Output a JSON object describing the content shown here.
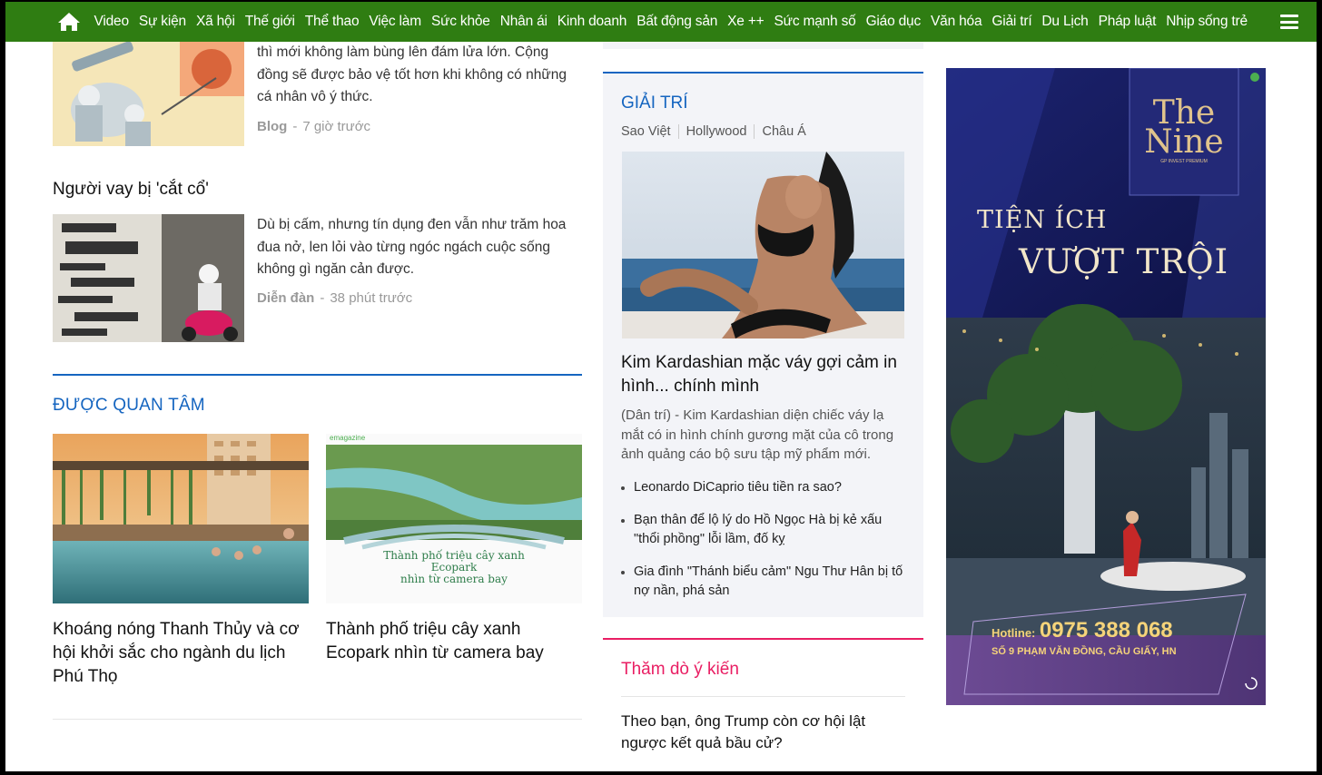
{
  "nav": {
    "items": [
      "Video",
      "Sự kiện",
      "Xã hội",
      "Thế giới",
      "Thể thao",
      "Việc làm",
      "Sức khỏe",
      "Nhân ái",
      "Kinh doanh",
      "Bất động sản",
      "Xe ++",
      "Sức mạnh số",
      "Giáo dục",
      "Văn hóa",
      "Giải trí",
      "Du Lịch",
      "Pháp luật",
      "Nhịp sống trẻ"
    ]
  },
  "left": {
    "story1": {
      "excerpt": "thì mới không làm bùng lên đám lửa lớn. Cộng đồng sẽ được bảo vệ tốt hơn khi không có những cá nhân vô ý thức.",
      "category": "Blog",
      "time": "7 giờ trước"
    },
    "story2": {
      "title": "Người vay bị 'cắt cổ'",
      "excerpt": "Dù bị cấm, nhưng tín dụng đen vẫn như trăm hoa đua nở, len lỏi vào từng ngóc ngách cuộc sống không gì ngăn cản được.",
      "category": "Diễn đàn",
      "time": "38 phút trước"
    },
    "separator": "-",
    "featured": {
      "heading": "ĐƯỢC QUAN TÂM",
      "cards": [
        {
          "title": "Khoáng nóng Thanh Thủy và cơ hội khởi sắc cho ngành du lịch Phú Thọ"
        },
        {
          "title": "Thành phố triệu cây xanh Ecopark nhìn từ camera bay",
          "img_caption_1": "Thành phố triệu cây xanh",
          "img_caption_2": "Ecopark",
          "img_caption_3": "nhìn từ camera bay",
          "img_tag": "emagazine"
        }
      ]
    }
  },
  "mid": {
    "label": "GIẢI TRÍ",
    "subcats": [
      "Sao Việt",
      "Hollywood",
      "Châu Á"
    ],
    "title": "Kim Kardashian mặc váy gợi cảm in hình... chính mình",
    "desc": "(Dân trí) - Kim Kardashian diện chiếc váy lạ mắt có in hình chính gương mặt của cô trong ảnh quảng cáo bộ sưu tập mỹ phẩm mới.",
    "links": [
      "Leonardo DiCaprio tiêu tiền ra sao?",
      "Bạn thân để lộ lý do Hồ Ngọc Hà bị kẻ xấu \"thổi phồng\" lỗi lầm, đố kỵ",
      "Gia đình \"Thánh biểu cảm\" Ngu Thư Hân bị tố nợ nần, phá sản"
    ]
  },
  "poll": {
    "title": "Thăm dò ý kiến",
    "question": "Theo bạn, ông Trump còn cơ hội lật ngược kết quả bầu cử?"
  },
  "ad": {
    "brand": "The Nine",
    "brand_sub": "GP INVEST PREMIUM",
    "headline_1": "TIỆN ÍCH",
    "headline_2": "VƯỢT TRỘI",
    "hotline_label": "Hotline:",
    "hotline": "0975 388 068",
    "address": "SỐ 9 PHẠM VĂN ĐỒNG, CẦU GIẤY, HN"
  },
  "colors": {
    "nav_bg": "#2f7d12",
    "section_blue": "#1565c0",
    "poll_pink": "#e91e63"
  }
}
